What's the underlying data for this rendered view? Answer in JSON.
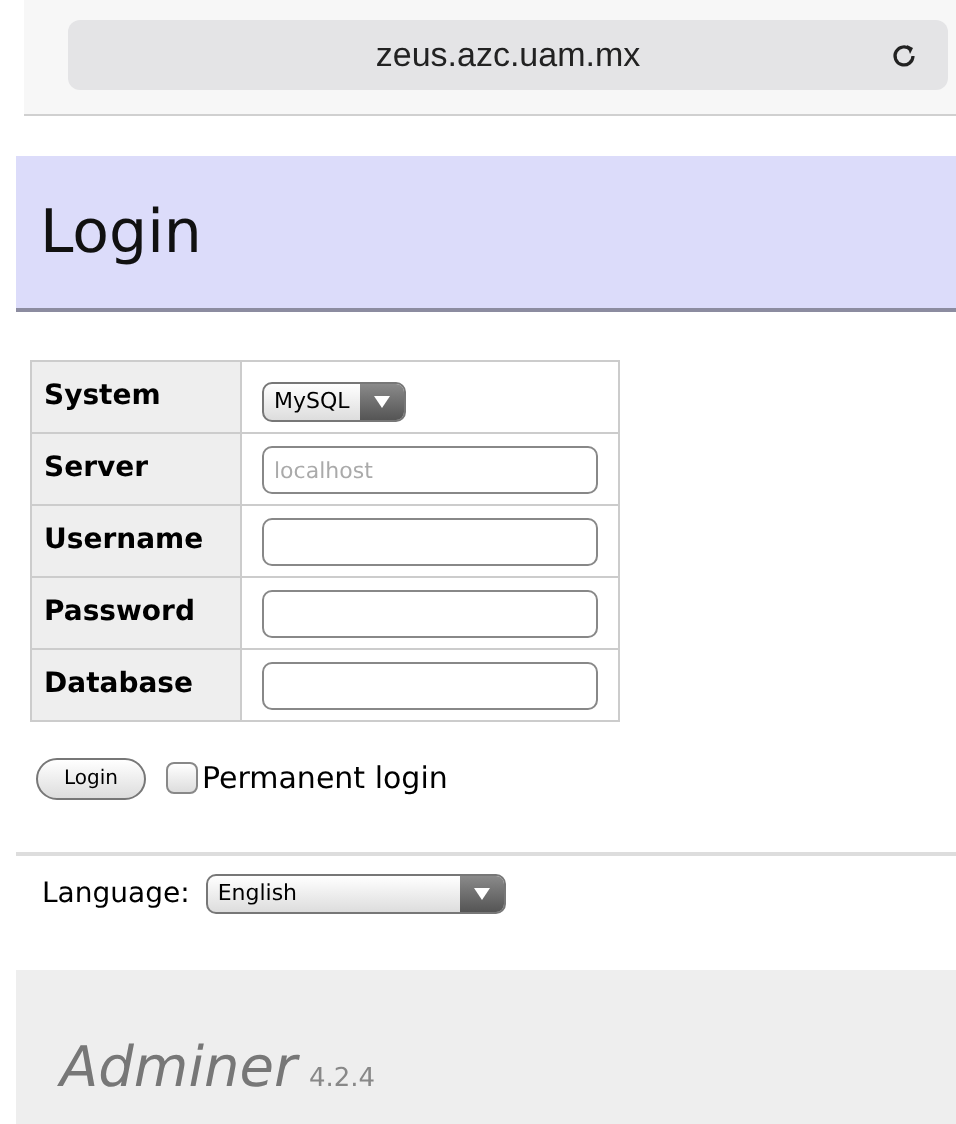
{
  "browser": {
    "address": "zeus.azc.uam.mx"
  },
  "header": {
    "title": "Login"
  },
  "form": {
    "rows": [
      {
        "label": "System",
        "kind": "select",
        "value": "MySQL"
      },
      {
        "label": "Server",
        "kind": "text",
        "placeholder": "localhost"
      },
      {
        "label": "Username",
        "kind": "text"
      },
      {
        "label": "Password",
        "kind": "text"
      },
      {
        "label": "Database",
        "kind": "text"
      }
    ],
    "submit": "Login",
    "permanent": {
      "label": "Permanent login",
      "checked": false
    }
  },
  "language": {
    "label": "Language:",
    "value": "English"
  },
  "footer": {
    "name": "Adminer",
    "version": "4.2.4"
  }
}
